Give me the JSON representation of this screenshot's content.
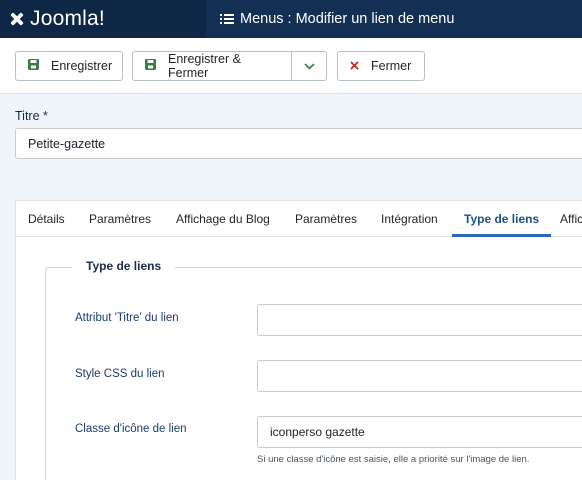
{
  "header": {
    "brand": "Joomla!",
    "title": "Menus : Modifier un lien de menu"
  },
  "toolbar": {
    "save_label": "Enregistrer",
    "save_close_label": "Enregistrer & Fermer",
    "close_label": "Fermer"
  },
  "form": {
    "title_label": "Titre *",
    "title_value": "Petite-gazette"
  },
  "tabs": [
    {
      "label": "Détails"
    },
    {
      "label": "Paramètres"
    },
    {
      "label": "Affichage du Blog"
    },
    {
      "label": "Paramètres"
    },
    {
      "label": "Intégration"
    },
    {
      "label": "Type de liens"
    },
    {
      "label": "Affic"
    }
  ],
  "active_tab_index": 5,
  "link_type": {
    "legend": "Type de liens",
    "fields": [
      {
        "label": "Attribut 'Titre' du lien",
        "value": ""
      },
      {
        "label": "Style CSS du lien",
        "value": ""
      },
      {
        "label": "Classe d'icône de lien",
        "value": "iconperso gazette"
      }
    ],
    "icon_help": "Si une classe d'icône est saisie, elle a priorité sur l'image de lien."
  },
  "colors": {
    "header_bg": "#132f53",
    "save_green": "#3a7a45",
    "close_red": "#c52827",
    "active_tab": "#1d4f8a"
  }
}
